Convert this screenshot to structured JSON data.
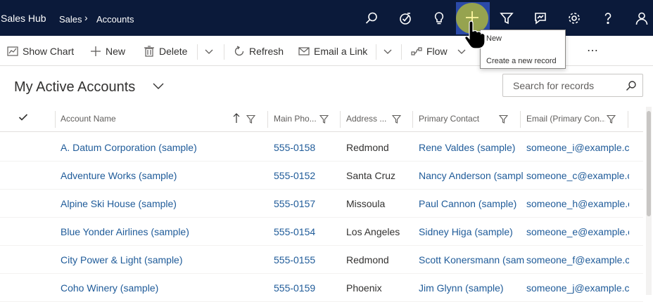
{
  "app": {
    "name": "Sales Hub"
  },
  "breadcrumb": {
    "area": "Sales",
    "entity": "Accounts"
  },
  "header_icons": [
    "search-icon",
    "task-icon",
    "lightbulb-icon",
    "add-icon",
    "filter-icon",
    "assistant-icon",
    "settings-icon",
    "help-icon",
    "user-icon"
  ],
  "tooltip": {
    "title": "New",
    "description": "Create a new record"
  },
  "command_bar": {
    "show_chart": "Show Chart",
    "new": "New",
    "delete": "Delete",
    "refresh": "Refresh",
    "email_link": "Email a Link",
    "flow": "Flow",
    "more": "⋯"
  },
  "view": {
    "title": "My Active Accounts"
  },
  "search": {
    "placeholder": "Search for records"
  },
  "columns": {
    "account_name": "Account Name",
    "main_phone": "Main Pho...",
    "address": "Address ...",
    "primary_contact": "Primary Contact",
    "email": "Email (Primary Con..."
  },
  "rows": [
    {
      "account_name": "A. Datum Corporation (sample)",
      "main_phone": "555-0158",
      "address": "Redmond",
      "primary_contact": "Rene Valdes (sample)",
      "email": "someone_i@example.co"
    },
    {
      "account_name": "Adventure Works (sample)",
      "main_phone": "555-0152",
      "address": "Santa Cruz",
      "primary_contact": "Nancy Anderson (sampl",
      "email": "someone_c@example.co"
    },
    {
      "account_name": "Alpine Ski House (sample)",
      "main_phone": "555-0157",
      "address": "Missoula",
      "primary_contact": "Paul Cannon (sample)",
      "email": "someone_h@example.co"
    },
    {
      "account_name": "Blue Yonder Airlines (sample)",
      "main_phone": "555-0154",
      "address": "Los Angeles",
      "primary_contact": "Sidney Higa (sample)",
      "email": "someone_e@example.co"
    },
    {
      "account_name": "City Power & Light (sample)",
      "main_phone": "555-0155",
      "address": "Redmond",
      "primary_contact": "Scott Konersmann (sam",
      "email": "someone_f@example.co"
    },
    {
      "account_name": "Coho Winery (sample)",
      "main_phone": "555-0159",
      "address": "Phoenix",
      "primary_contact": "Jim Glynn (sample)",
      "email": "someone_j@example.co"
    }
  ],
  "colors": {
    "topbar": "#0b1a3a",
    "link": "#1f5b99",
    "highlight": "#2b4aa8",
    "cursor_circle": "#9ca84a"
  }
}
